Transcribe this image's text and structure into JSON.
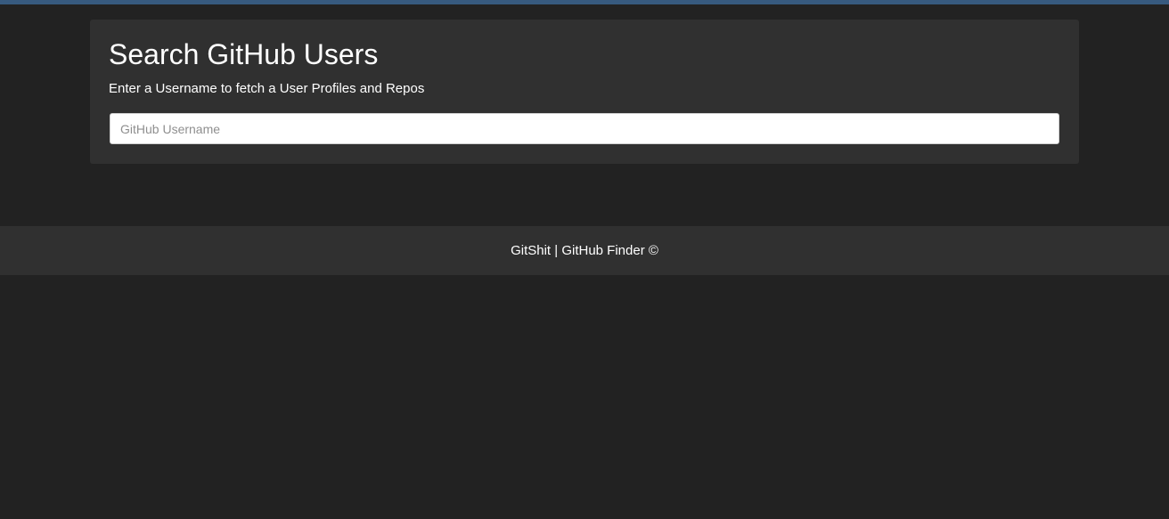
{
  "colors": {
    "accent": "#375a7f",
    "background": "#222222",
    "panel": "#303030",
    "text": "#ffffff"
  },
  "search": {
    "title": "Search GitHub Users",
    "subtitle": "Enter a Username to fetch a User Profiles and Repos",
    "value": "",
    "placeholder": "GitHub Username"
  },
  "footer": {
    "text": "GitShit | GitHub Finder ©"
  }
}
